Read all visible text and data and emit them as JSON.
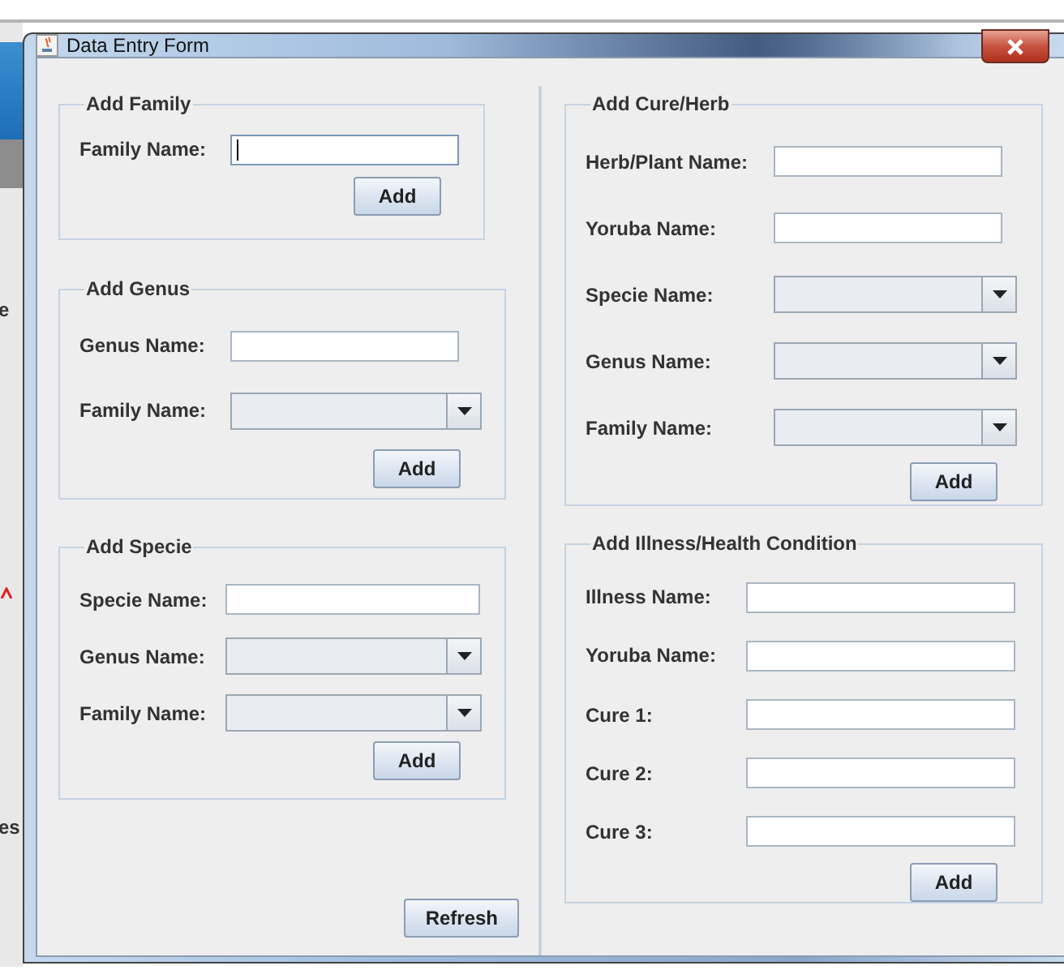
{
  "backdrop": {
    "fragments": [
      "e",
      "es"
    ]
  },
  "window": {
    "title": "Data Entry Form"
  },
  "left_groups": [
    {
      "title": "Add Family",
      "fields": [
        {
          "label": "Family Name:",
          "kind": "text",
          "focused": true
        }
      ],
      "button": "Add"
    },
    {
      "title": "Add Genus",
      "fields": [
        {
          "label": "Genus Name:",
          "kind": "text",
          "focused": false
        },
        {
          "label": "Family Name:",
          "kind": "combo",
          "focused": false
        }
      ],
      "button": "Add"
    },
    {
      "title": "Add Specie",
      "fields": [
        {
          "label": "Specie Name:",
          "kind": "text",
          "focused": false
        },
        {
          "label": "Genus Name:",
          "kind": "combo",
          "focused": false
        },
        {
          "label": "Family Name:",
          "kind": "combo",
          "focused": false
        }
      ],
      "button": "Add"
    }
  ],
  "refresh_button": "Refresh",
  "right_groups": [
    {
      "title": "Add Cure/Herb",
      "fields": [
        {
          "label": "Herb/Plant Name:",
          "kind": "text",
          "focused": false
        },
        {
          "label": "Yoruba Name:",
          "kind": "text",
          "focused": false
        },
        {
          "label": "Specie Name:",
          "kind": "combo",
          "focused": false
        },
        {
          "label": "Genus Name:",
          "kind": "combo",
          "focused": false
        },
        {
          "label": "Family Name:",
          "kind": "combo",
          "focused": false
        }
      ],
      "button": "Add"
    },
    {
      "title": "Add Illness/Health Condition",
      "fields": [
        {
          "label": "Illness Name:",
          "kind": "text",
          "focused": false
        },
        {
          "label": "Yoruba Name:",
          "kind": "text",
          "focused": false
        },
        {
          "label": "Cure 1:",
          "kind": "text",
          "focused": false
        },
        {
          "label": "Cure 2:",
          "kind": "text",
          "focused": false
        },
        {
          "label": "Cure 3:",
          "kind": "text",
          "focused": false
        }
      ],
      "button": "Add"
    }
  ]
}
